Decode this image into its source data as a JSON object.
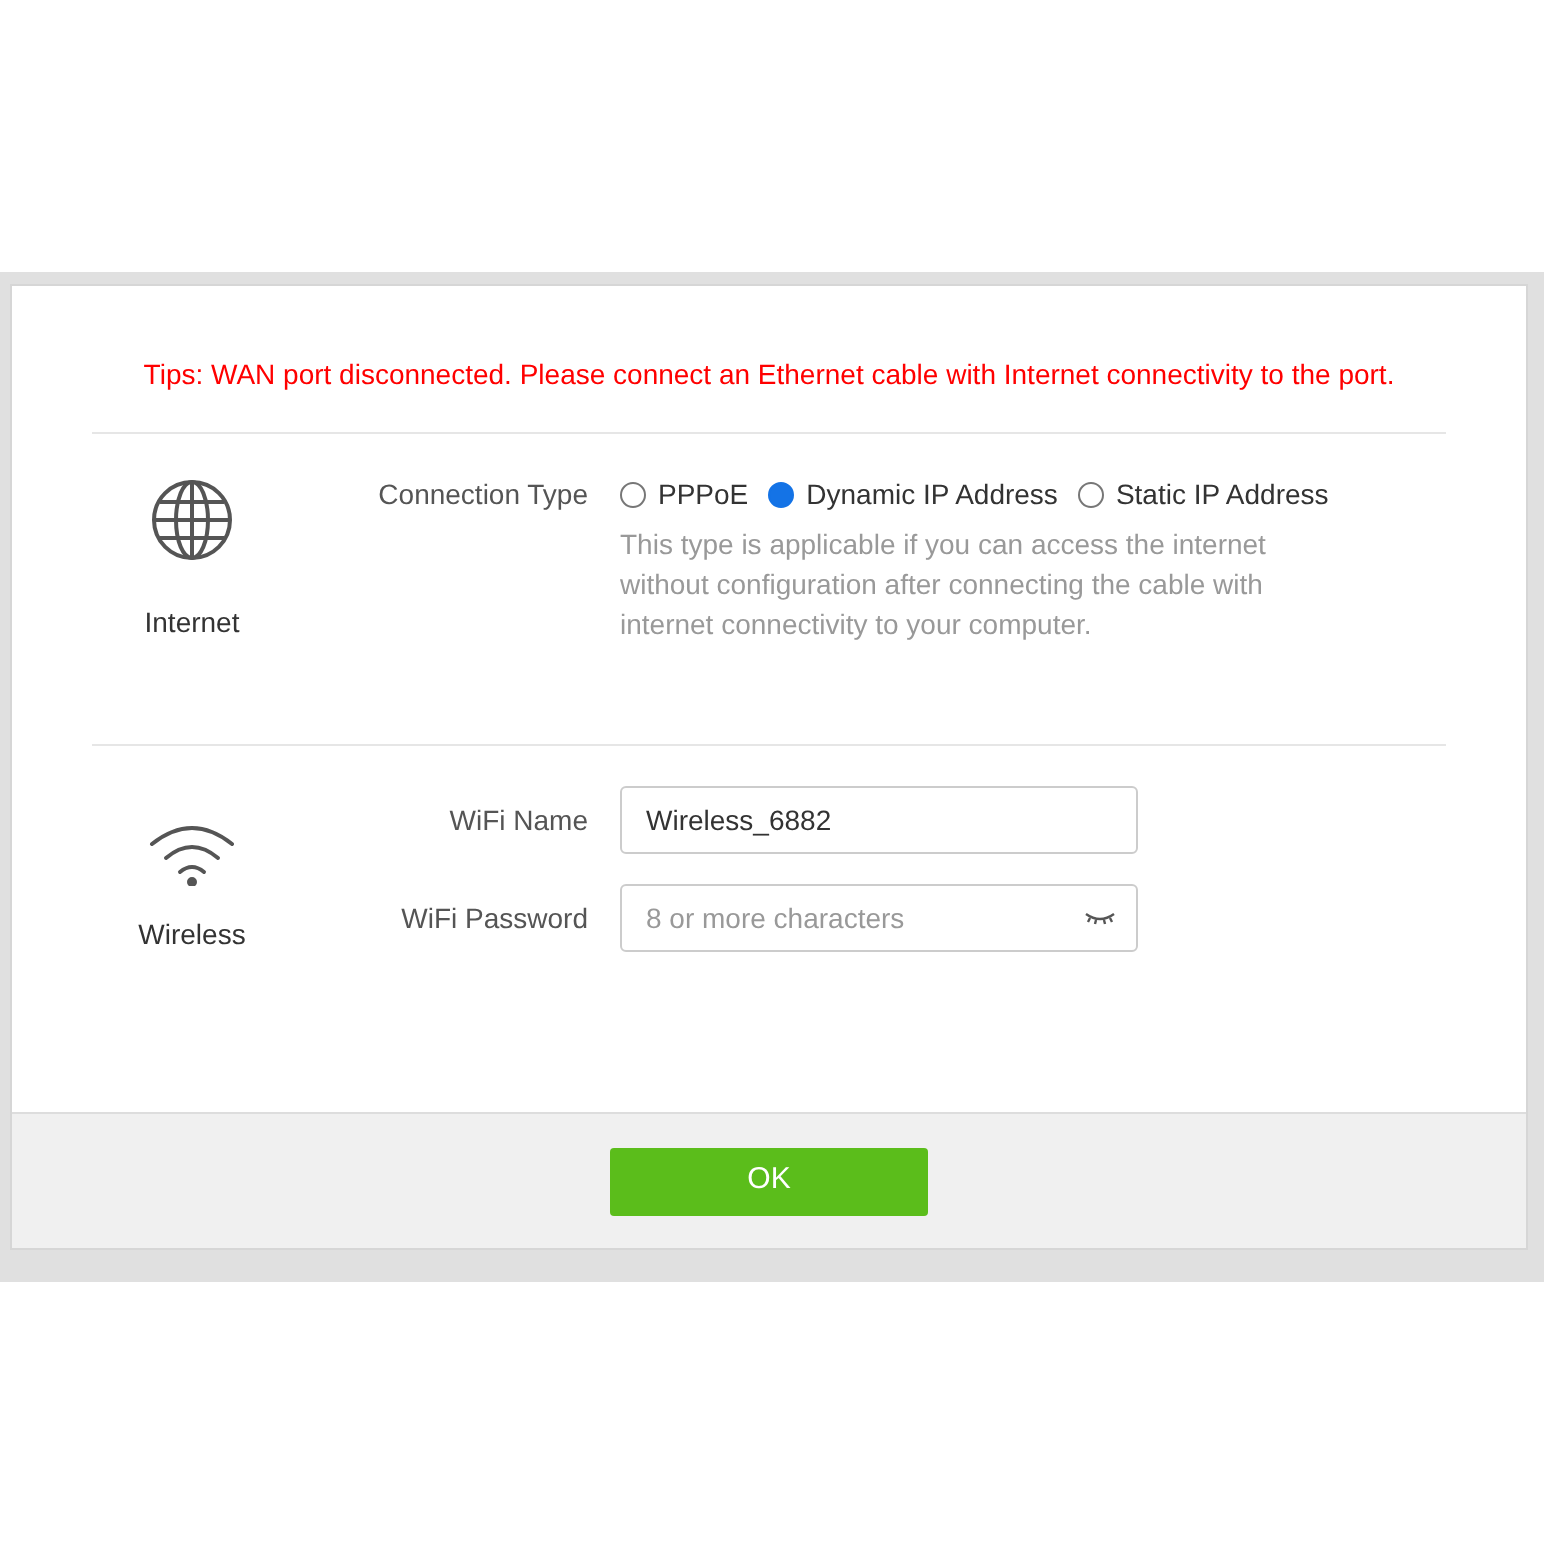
{
  "tip": "Tips: WAN port disconnected. Please connect an Ethernet cable with Internet connectivity to the port.",
  "internet": {
    "title": "Internet",
    "connection_label": "Connection Type",
    "options": [
      {
        "label": "PPPoE",
        "selected": false
      },
      {
        "label": "Dynamic IP Address",
        "selected": true
      },
      {
        "label": "Static IP Address",
        "selected": false
      }
    ],
    "description": "This type is applicable if you can access the internet without configuration after connecting the cable with internet connectivity to your computer."
  },
  "wireless": {
    "title": "Wireless",
    "fields": [
      {
        "label": "WiFi Name",
        "value": "Wireless_6882",
        "kind": "text"
      },
      {
        "label": "WiFi Password",
        "placeholder": "8 or more characters",
        "kind": "password"
      }
    ]
  },
  "ok_button": "OK"
}
